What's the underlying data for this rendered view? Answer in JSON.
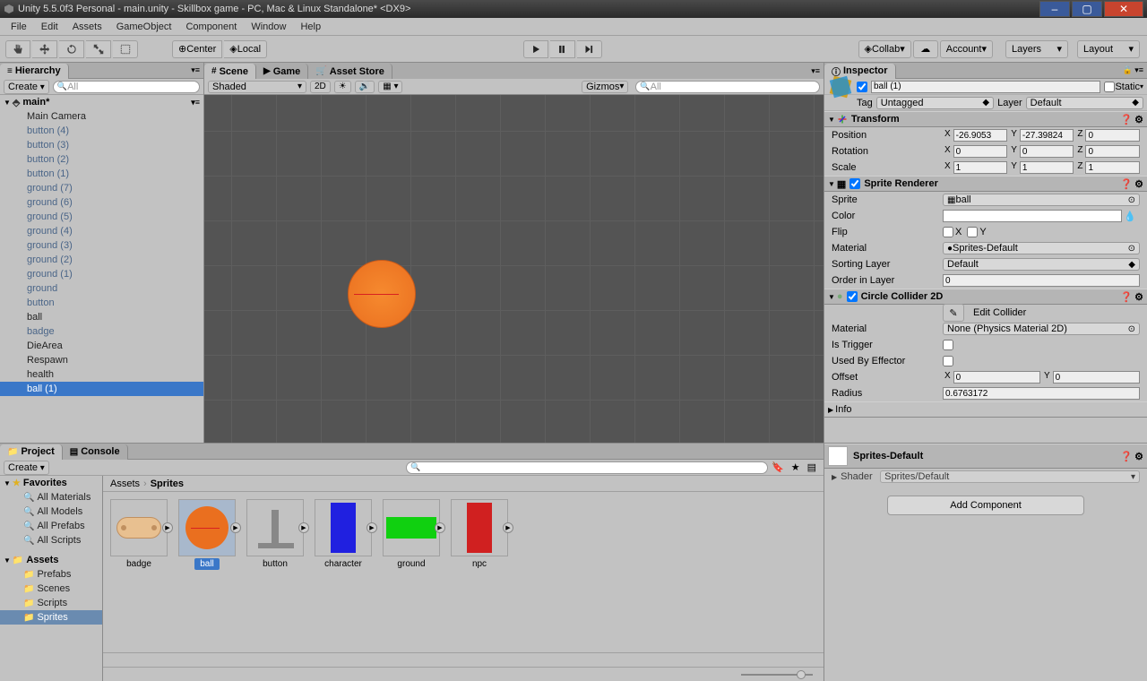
{
  "window": {
    "title": "Unity 5.5.0f3 Personal - main.unity - Skillbox game - PC, Mac & Linux Standalone* <DX9>"
  },
  "menus": [
    "File",
    "Edit",
    "Assets",
    "GameObject",
    "Component",
    "Window",
    "Help"
  ],
  "toolbar": {
    "center": "Center",
    "local": "Local",
    "collab": "Collab",
    "account": "Account",
    "layers": "Layers",
    "layout": "Layout"
  },
  "hierarchy": {
    "title": "Hierarchy",
    "create": "Create",
    "search_ph": "All",
    "scene": "main*",
    "rootIcon": "⬤",
    "items": [
      {
        "name": "Main Camera",
        "black": true
      },
      {
        "name": "button (4)"
      },
      {
        "name": "button (3)"
      },
      {
        "name": "button (2)"
      },
      {
        "name": "button (1)"
      },
      {
        "name": "ground (7)"
      },
      {
        "name": "ground (6)"
      },
      {
        "name": "ground (5)"
      },
      {
        "name": "ground (4)"
      },
      {
        "name": "ground (3)"
      },
      {
        "name": "ground (2)"
      },
      {
        "name": "ground (1)"
      },
      {
        "name": "ground"
      },
      {
        "name": "button"
      },
      {
        "name": "ball",
        "black": true
      },
      {
        "name": "badge"
      },
      {
        "name": "DieArea",
        "black": true
      },
      {
        "name": "Respawn",
        "black": true
      },
      {
        "name": "health",
        "black": true
      },
      {
        "name": "ball (1)",
        "sel": true,
        "black": true
      }
    ]
  },
  "viewport": {
    "tabs": [
      "Scene",
      "Game",
      "Asset Store"
    ],
    "shaded": "Shaded",
    "mode2d": "2D",
    "gizmos": "Gizmos",
    "search_ph": "All"
  },
  "inspector": {
    "title": "Inspector",
    "obj_name": "ball (1)",
    "static": "Static",
    "tag_label": "Tag",
    "tag": "Untagged",
    "layer_label": "Layer",
    "layer": "Default",
    "transform": {
      "title": "Transform",
      "position_label": "Position",
      "position": {
        "x": "-26.9053",
        "y": "-27.39824",
        "z": "0"
      },
      "rotation_label": "Rotation",
      "rotation": {
        "x": "0",
        "y": "0",
        "z": "0"
      },
      "scale_label": "Scale",
      "scale": {
        "x": "1",
        "y": "1",
        "z": "1"
      }
    },
    "sprite_renderer": {
      "title": "Sprite Renderer",
      "sprite_label": "Sprite",
      "sprite": "ball",
      "color_label": "Color",
      "flip_label": "Flip",
      "flip_x": "X",
      "flip_y": "Y",
      "material_label": "Material",
      "material": "Sprites-Default",
      "sorting_layer_label": "Sorting Layer",
      "sorting_layer": "Default",
      "order_label": "Order in Layer",
      "order": "0"
    },
    "collider": {
      "title": "Circle Collider 2D",
      "edit_collider": "Edit Collider",
      "material_label": "Material",
      "material": "None (Physics Material 2D)",
      "is_trigger_label": "Is Trigger",
      "used_by_effector_label": "Used By Effector",
      "offset_label": "Offset",
      "offset": {
        "x": "0",
        "y": "0"
      },
      "radius_label": "Radius",
      "radius": "0.6763172"
    },
    "info": "Info",
    "material_preview": {
      "name": "Sprites-Default",
      "shader_label": "Shader",
      "shader": "Sprites/Default"
    },
    "add_component": "Add Component"
  },
  "project": {
    "tabs": [
      "Project",
      "Console"
    ],
    "create": "Create",
    "favorites": "Favorites",
    "fav_items": [
      "All Materials",
      "All Models",
      "All Prefabs",
      "All Scripts"
    ],
    "assets_header": "Assets",
    "folders": [
      "Prefabs",
      "Scenes",
      "Scripts",
      "Sprites"
    ],
    "breadcrumb": [
      "Assets",
      "Sprites"
    ],
    "sprites": [
      {
        "name": "badge"
      },
      {
        "name": "ball",
        "sel": true
      },
      {
        "name": "button"
      },
      {
        "name": "character"
      },
      {
        "name": "ground"
      },
      {
        "name": "npc"
      }
    ]
  }
}
